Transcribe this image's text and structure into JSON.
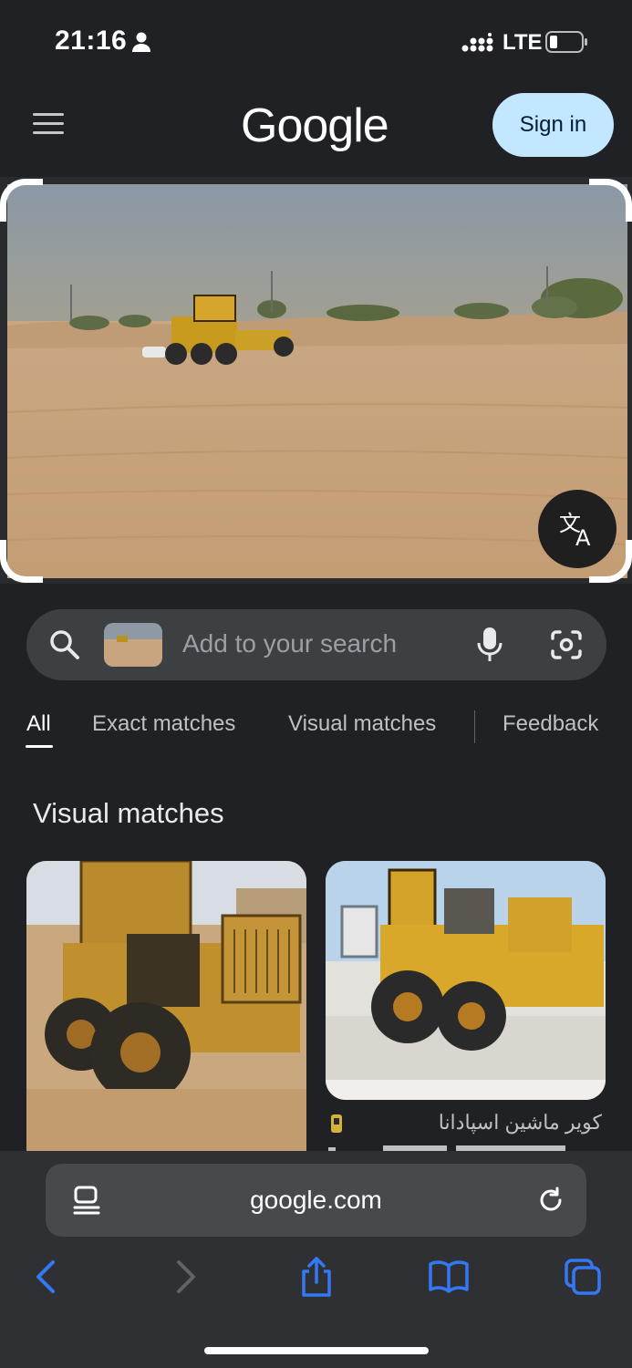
{
  "status_bar": {
    "time": "21:16",
    "network": "LTE"
  },
  "header": {
    "logo": "Google",
    "sign_in": "Sign in"
  },
  "search": {
    "placeholder": "Add to your search"
  },
  "tabs": [
    "All",
    "Exact matches",
    "Visual matches",
    "Feedback"
  ],
  "section_title": "Visual matches",
  "results": [
    {
      "source": "",
      "title": ""
    },
    {
      "source": "کویر ماشین اسپادانا",
      "title": ""
    }
  ],
  "browser": {
    "url": "google.com"
  },
  "colors": {
    "signin_bg": "#c2e7ff",
    "safari_accent": "#3478f6",
    "background": "#202124"
  },
  "icons": [
    "menu-icon",
    "person-icon",
    "signal-icon",
    "battery-icon",
    "translate-icon",
    "search-icon",
    "mic-icon",
    "lens-camera-icon",
    "reader-icon",
    "reload-icon",
    "back-icon",
    "forward-icon",
    "share-icon",
    "bookmarks-icon",
    "tabs-icon"
  ]
}
